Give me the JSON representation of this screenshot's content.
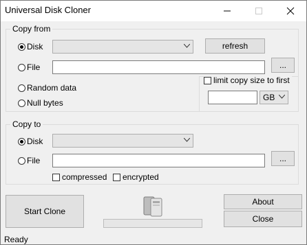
{
  "window": {
    "title": "Universal Disk Cloner"
  },
  "copy_from": {
    "group_label": "Copy from",
    "disk_label": "Disk",
    "refresh_label": "refresh",
    "file_label": "File",
    "browse_label": "...",
    "random_label": "Random data",
    "null_label": "Null bytes",
    "limit_label": "limit copy size to first",
    "unit": "GB",
    "selected": "disk"
  },
  "copy_to": {
    "group_label": "Copy to",
    "disk_label": "Disk",
    "file_label": "File",
    "browse_label": "...",
    "compressed_label": "compressed",
    "encrypted_label": "encrypted",
    "selected": "disk"
  },
  "actions": {
    "start_label": "Start Clone",
    "about_label": "About",
    "close_label": "Close"
  },
  "progress": {
    "value": 0
  },
  "status": {
    "text": "Ready"
  },
  "icons": {
    "app": "drive-icon",
    "minimize": "minimize-icon",
    "maximize": "maximize-icon",
    "close": "close-icon",
    "dropdown": "chevron-down-icon"
  }
}
